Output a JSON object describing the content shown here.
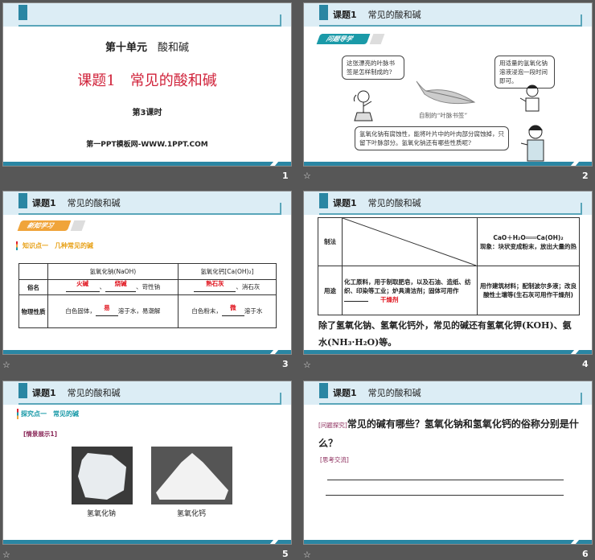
{
  "header_title": {
    "course": "课题1",
    "topic": "常见的酸和碱"
  },
  "slides": [
    {
      "number": "1",
      "unit": "第十单元",
      "unit_topic": "酸和碱",
      "title": "课题1　常见的酸和碱",
      "period": "第3课时",
      "site": "第一PPT模板网-WWW.1PPT.COM"
    },
    {
      "number": "2",
      "tag": "问题导学",
      "bubble1": "这张漂亮的叶脉书签是怎样制成的?",
      "bubble2": "用适量的氢氧化钠溶液浸泡一段时间即可。",
      "caption": "自制的“叶脉书签”",
      "bubble3": "氢氧化钠有腐蚀性，能将叶片中的叶肉部分腐蚀掉，只留下叶脉部分。氢氧化钠还有哪些性质呢?"
    },
    {
      "number": "3",
      "tag": "新知学习",
      "point": "知识点一　几种常见的碱",
      "table": {
        "col1": "氢氧化钠(NaOH)",
        "col2": "氢氧化钙[Ca(OH)₂]",
        "row1_label": "俗名",
        "naoh_name1": "火碱",
        "naoh_name2": "烧碱",
        "naoh_name3": "、苛性钠",
        "caoh_name1": "熟石灰",
        "caoh_name2": "、消石灰",
        "row2_label": "物理性质",
        "naoh_prop_a": "白色固体，",
        "naoh_prop_blank": "易",
        "naoh_prop_b": "溶于水，易潮解",
        "caoh_prop_a": "白色粉末，",
        "caoh_prop_blank": "微",
        "caoh_prop_b": "溶于水"
      }
    },
    {
      "number": "4",
      "table": {
        "row1_label": "制法",
        "equation": "CaO＋H₂O═══Ca(OH)₂",
        "phenomenon": "现象：块状变成粉末，放出大量的热",
        "row2_label": "用途",
        "naoh_use": "化工原料，用于制取肥皂，以及石油、造纸、纺织、印染等工业；炉具清洁剂；固体可用作",
        "naoh_use_answer": "干燥剂",
        "caoh_use": "用作建筑材料；配制波尔多液；改良酸性土壤等(生石灰可用作干燥剂)"
      },
      "note": "除了氢氧化钠、氢氧化钙外，常见的碱还有氢氧化钾(KOH)、氨水(NH₃·H₂O)等。"
    },
    {
      "number": "5",
      "point": "探究点一　常见的碱",
      "label": "[情景展示1]",
      "caption1": "氢氧化钠",
      "caption2": "氢氧化钙"
    },
    {
      "number": "6",
      "label1": "[问题探究]",
      "question": "常见的碱有哪些？氢氧化钠和氢氧化钙的俗称分别是什么？",
      "label2": "[思考交流]"
    }
  ],
  "colors": {
    "teal": "#2a86a3",
    "red": "#d0223a",
    "orange": "#f0a43a"
  }
}
